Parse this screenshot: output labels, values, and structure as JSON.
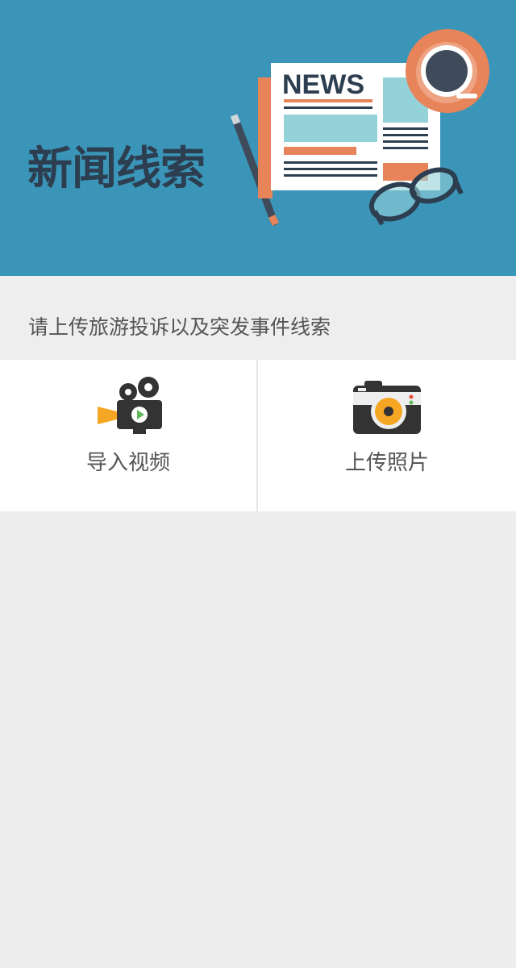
{
  "banner": {
    "title": "新闻线索",
    "newspaper_text": "NEWS",
    "background_color": "#3b95b8"
  },
  "prompt": {
    "text": "请上传旅游投诉以及突发事件线索"
  },
  "actions": [
    {
      "label": "导入视频",
      "icon": "video-camera-icon"
    },
    {
      "label": "上传照片",
      "icon": "photo-camera-icon"
    }
  ],
  "colors": {
    "accent_orange": "#e8845a",
    "dark": "#2c3e50",
    "page_bg": "#ededed"
  }
}
